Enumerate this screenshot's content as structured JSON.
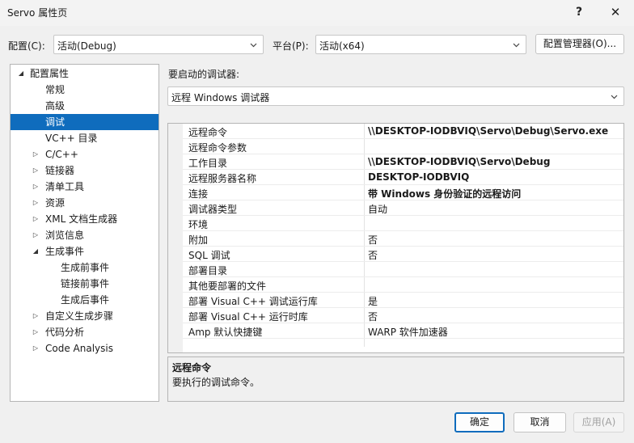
{
  "window": {
    "title": "Servo 属性页",
    "help_glyph": "?",
    "close_glyph": "✕"
  },
  "toolbar": {
    "config_label": "配置(C):",
    "config_value": "活动(Debug)",
    "platform_label": "平台(P):",
    "platform_value": "活动(x64)",
    "config_manager_button": "配置管理器(O)..."
  },
  "tree": {
    "items": [
      {
        "label": "配置属性",
        "arrow": "◢",
        "indent": 0
      },
      {
        "label": "常规",
        "arrow": "",
        "indent": 1
      },
      {
        "label": "高级",
        "arrow": "",
        "indent": 1
      },
      {
        "label": "调试",
        "arrow": "",
        "indent": 1,
        "selected": true
      },
      {
        "label": "VC++ 目录",
        "arrow": "",
        "indent": 1
      },
      {
        "label": "C/C++",
        "arrow": "▷",
        "indent": 1
      },
      {
        "label": "链接器",
        "arrow": "▷",
        "indent": 1
      },
      {
        "label": "清单工具",
        "arrow": "▷",
        "indent": 1
      },
      {
        "label": "资源",
        "arrow": "▷",
        "indent": 1
      },
      {
        "label": "XML 文档生成器",
        "arrow": "▷",
        "indent": 1
      },
      {
        "label": "浏览信息",
        "arrow": "▷",
        "indent": 1
      },
      {
        "label": "生成事件",
        "arrow": "◢",
        "indent": 1
      },
      {
        "label": "生成前事件",
        "arrow": "",
        "indent": 2
      },
      {
        "label": "链接前事件",
        "arrow": "",
        "indent": 2
      },
      {
        "label": "生成后事件",
        "arrow": "",
        "indent": 2
      },
      {
        "label": "自定义生成步骤",
        "arrow": "▷",
        "indent": 1
      },
      {
        "label": "代码分析",
        "arrow": "▷",
        "indent": 1
      },
      {
        "label": "Code Analysis",
        "arrow": "▷",
        "indent": 1
      }
    ]
  },
  "debugger": {
    "heading": "要启动的调试器:",
    "selected": "远程 Windows 调试器"
  },
  "properties": [
    {
      "name": "远程命令",
      "value": "\\\\DESKTOP-IODBVIQ\\Servo\\Debug\\Servo.exe",
      "bold": true
    },
    {
      "name": "远程命令参数",
      "value": "",
      "bold": false
    },
    {
      "name": "工作目录",
      "value": "\\\\DESKTOP-IODBVIQ\\Servo\\Debug",
      "bold": true
    },
    {
      "name": "远程服务器名称",
      "value": "DESKTOP-IODBVIQ",
      "bold": true
    },
    {
      "name": "连接",
      "value": "带 Windows 身份验证的远程访问",
      "bold": true
    },
    {
      "name": "调试器类型",
      "value": "自动",
      "bold": false
    },
    {
      "name": "环境",
      "value": "",
      "bold": false
    },
    {
      "name": "附加",
      "value": "否",
      "bold": false
    },
    {
      "name": "SQL 调试",
      "value": "否",
      "bold": false
    },
    {
      "name": "部署目录",
      "value": "",
      "bold": false
    },
    {
      "name": "其他要部署的文件",
      "value": "",
      "bold": false
    },
    {
      "name": "部署 Visual C++ 调试运行库",
      "value": "是",
      "bold": false
    },
    {
      "name": "部署 Visual C++ 运行时库",
      "value": "否",
      "bold": false
    },
    {
      "name": "Amp 默认快捷键",
      "value": "WARP 软件加速器",
      "bold": false
    }
  ],
  "description": {
    "title": "远程命令",
    "text": "要执行的调试命令。"
  },
  "footer": {
    "ok": "确定",
    "cancel": "取消",
    "apply": "应用(A)"
  },
  "colors": {
    "accent": "#0f6cbd"
  }
}
